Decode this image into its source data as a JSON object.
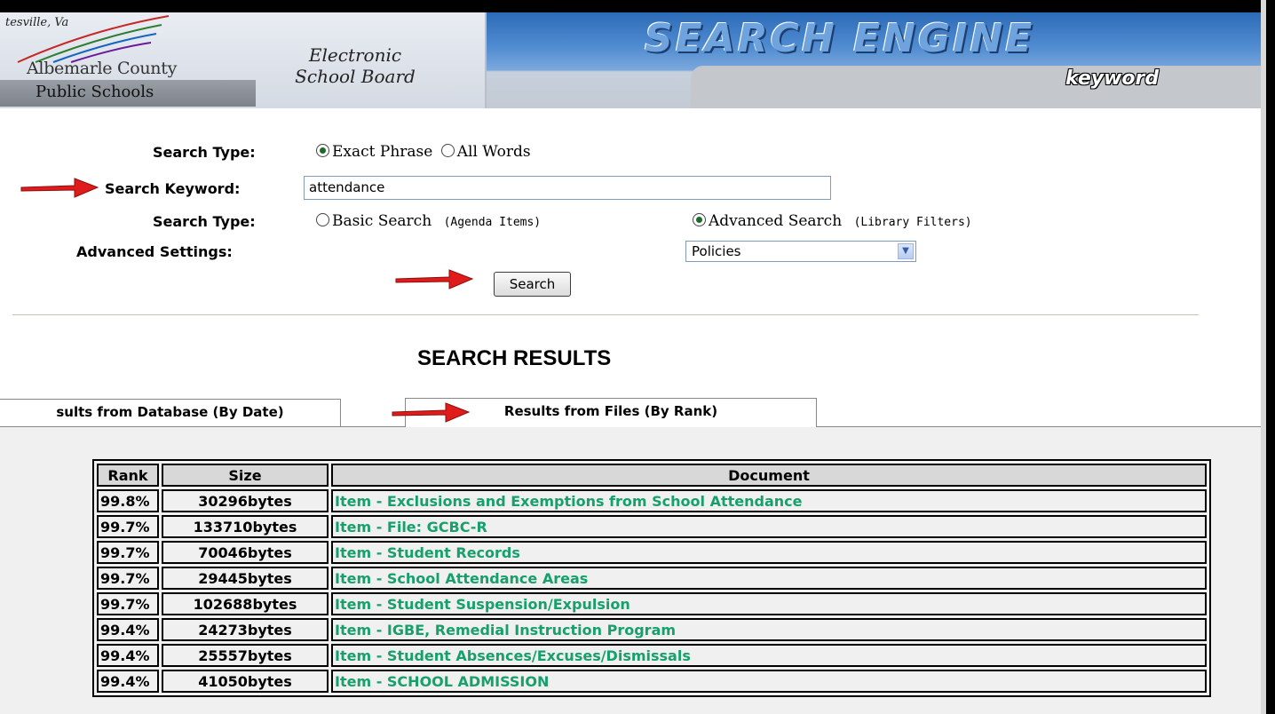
{
  "header": {
    "city": "tesville, Va",
    "org_line1": "Albemarle County",
    "org_line2": "Public Schools",
    "app_line1": "Electronic",
    "app_line2": "School Board",
    "banner_title": "SEARCH ENGINE",
    "banner_subtitle": "keyword"
  },
  "form": {
    "match_type": {
      "label": "Search Type:",
      "options": [
        "Exact Phrase",
        "All Words"
      ],
      "selected": "Exact Phrase"
    },
    "keyword": {
      "label": "Search Keyword:",
      "value": "attendance"
    },
    "search_type": {
      "label": "Search Type:",
      "basic_label": "Basic Search",
      "basic_note": "(Agenda Items)",
      "advanced_label": "Advanced Search",
      "advanced_note": "(Library Filters)",
      "selected": "Advanced Search"
    },
    "advanced_settings": {
      "label": "Advanced Settings:",
      "selected": "Policies"
    },
    "search_button": "Search"
  },
  "results": {
    "title": "SEARCH RESULTS",
    "tabs": [
      {
        "label": "sults from Database (By Date)",
        "active": false
      },
      {
        "label": "Results from Files (By Rank)",
        "active": true
      }
    ],
    "columns": [
      "Rank",
      "Size",
      "Document"
    ],
    "rows": [
      {
        "rank": "99.8%",
        "size": "30296bytes",
        "document": "Item - Exclusions and Exemptions from School Attendance"
      },
      {
        "rank": "99.7%",
        "size": "133710bytes",
        "document": "Item - File: GCBC-R"
      },
      {
        "rank": "99.7%",
        "size": "70046bytes",
        "document": "Item - Student Records"
      },
      {
        "rank": "99.7%",
        "size": "29445bytes",
        "document": "Item - School Attendance Areas"
      },
      {
        "rank": "99.7%",
        "size": "102688bytes",
        "document": "Item - Student Suspension/Expulsion"
      },
      {
        "rank": "99.4%",
        "size": "24273bytes",
        "document": "Item - IGBE, Remedial Instruction Program"
      },
      {
        "rank": "99.4%",
        "size": "25557bytes",
        "document": "Item - Student Absences/Excuses/Dismissals"
      },
      {
        "rank": "99.4%",
        "size": "41050bytes",
        "document": "Item - SCHOOL ADMISSION"
      }
    ]
  },
  "colors": {
    "link": "#17a06c",
    "annotation_arrow": "#e01b1b",
    "banner_blue": "#2c6bb8"
  }
}
